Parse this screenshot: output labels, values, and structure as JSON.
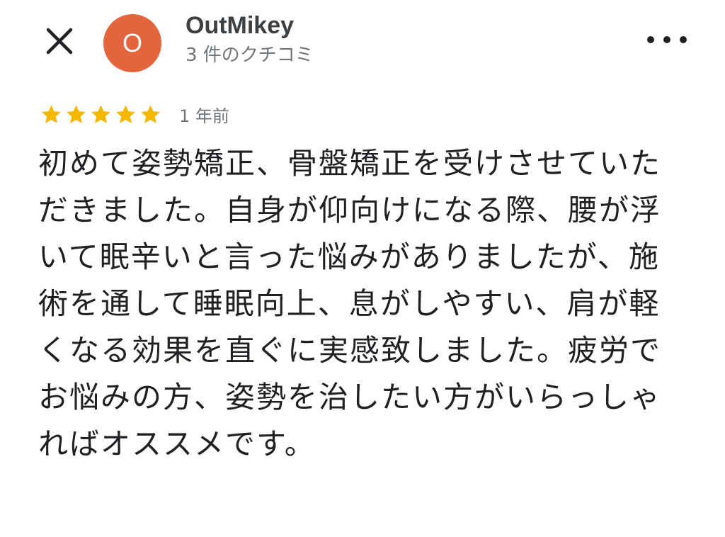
{
  "header": {
    "close_icon": "close-icon",
    "avatar_initial": "O",
    "avatar_color": "#e3653e",
    "user_name": "OutMikey",
    "review_count": "3 件のクチコミ",
    "more_icon": "more-horizontal-icon"
  },
  "review": {
    "rating": 5,
    "max_rating": 5,
    "star_color": "#f5b800",
    "time_ago": "1 年前",
    "text": "初めて姿勢矯正、骨盤矯正を受けさせていただきました。自身が仰向けになる際、腰が浮いて眠辛いと言った悩みがありましたが、施術を通して睡眠向上、息がしやすい、肩が軽くなる効果を直ぐに実感致しました。疲労でお悩みの方、姿勢を治したい方がいらっしゃればオススメです。"
  }
}
